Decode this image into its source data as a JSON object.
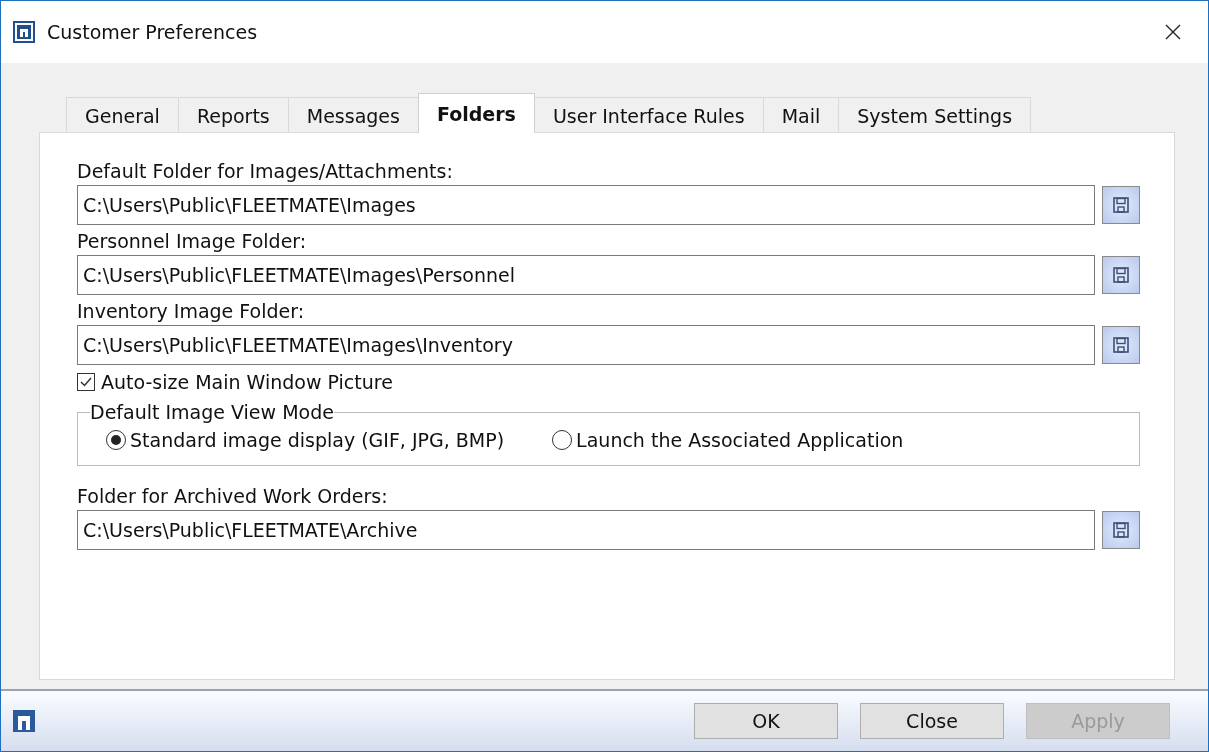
{
  "window": {
    "title": "Customer Preferences"
  },
  "tabs": [
    {
      "label": "General",
      "selected": false
    },
    {
      "label": "Reports",
      "selected": false
    },
    {
      "label": "Messages",
      "selected": false
    },
    {
      "label": "Folders",
      "selected": true
    },
    {
      "label": "User Interface Rules",
      "selected": false
    },
    {
      "label": "Mail",
      "selected": false
    },
    {
      "label": "System Settings",
      "selected": false
    }
  ],
  "folders": [
    {
      "label": "Default Folder for Images/Attachments:",
      "value": "C:\\Users\\Public\\FLEETMATE\\Images"
    },
    {
      "label": "Personnel Image Folder:",
      "value": "C:\\Users\\Public\\FLEETMATE\\Images\\Personnel"
    },
    {
      "label": "Inventory Image Folder:",
      "value": "C:\\Users\\Public\\FLEETMATE\\Images\\Inventory"
    }
  ],
  "auto_size": {
    "label": "Auto-size Main Window Picture",
    "checked": true
  },
  "view_mode": {
    "title": "Default Image View Mode",
    "options": [
      {
        "label": "Standard image display (GIF, JPG, BMP)",
        "selected": true
      },
      {
        "label": "Launch the Associated Application",
        "selected": false
      }
    ]
  },
  "archive": {
    "label": "Folder for Archived Work Orders:",
    "value": "C:\\Users\\Public\\FLEETMATE\\Archive"
  },
  "buttons": [
    {
      "label": "OK",
      "disabled": false
    },
    {
      "label": "Close",
      "disabled": false
    },
    {
      "label": "Apply",
      "disabled": true
    }
  ]
}
